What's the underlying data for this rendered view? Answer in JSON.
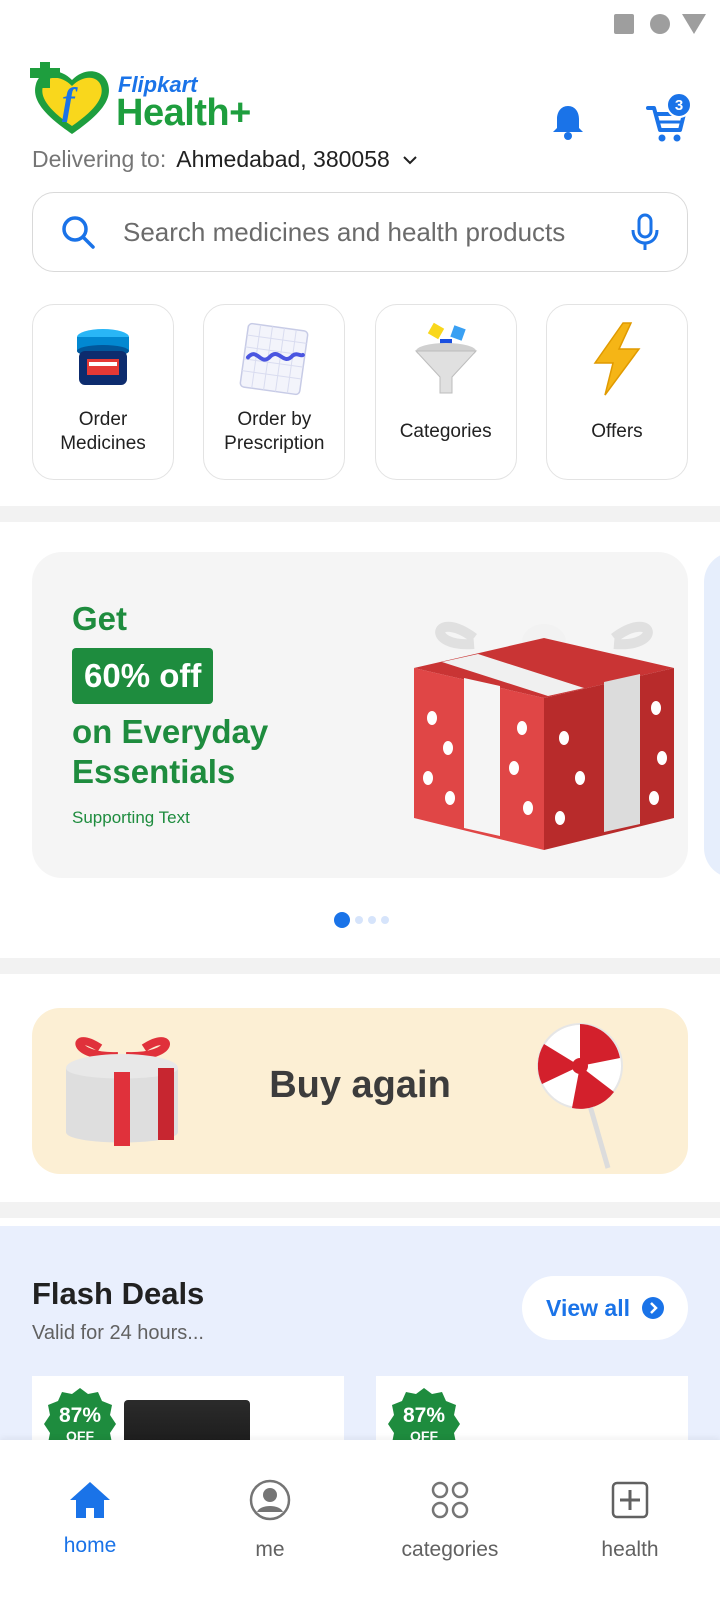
{
  "header": {
    "logo_line1": "Flipkart",
    "logo_line2": "Health+",
    "cart_count": "3",
    "delivering_label": "Delivering to:",
    "delivering_location": "Ahmedabad, 380058"
  },
  "search": {
    "placeholder": "Search medicines and health products"
  },
  "quick_actions": [
    {
      "label": "Order Medicines",
      "icon": "medicine-jar-icon"
    },
    {
      "label": "Order by Prescription",
      "icon": "prescription-icon"
    },
    {
      "label": "Categories",
      "icon": "funnel-icon"
    },
    {
      "label": "Offers",
      "icon": "lightning-icon"
    }
  ],
  "banner": {
    "line1": "Get",
    "highlight": "60% off",
    "line2": "on Everyday Essentials",
    "supporting": "Supporting Text",
    "slides": 4,
    "active_slide": 1
  },
  "buy_again": {
    "label": "Buy again"
  },
  "flash_deals": {
    "title": "Flash Deals",
    "subtitle": "Valid for 24 hours...",
    "view_all": "View all",
    "products": [
      {
        "discount": "87%",
        "off_label": "OFF"
      },
      {
        "discount": "87%",
        "off_label": "OFF"
      }
    ]
  },
  "bottom_nav": [
    {
      "label": "home",
      "icon": "home-icon",
      "active": true
    },
    {
      "label": "me",
      "icon": "profile-icon",
      "active": false
    },
    {
      "label": "categories",
      "icon": "grid-icon",
      "active": false
    },
    {
      "label": "health",
      "icon": "health-plus-icon",
      "active": false
    }
  ],
  "colors": {
    "brand_blue": "#1a73e8",
    "brand_green": "#1e8c3e",
    "buy_again_bg": "#fcefd4",
    "flash_bg": "#e9effd"
  }
}
